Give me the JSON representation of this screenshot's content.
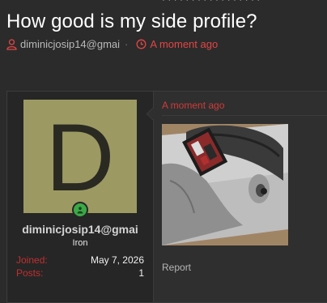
{
  "thread": {
    "title": "How good is my side profile?",
    "author": "diminicjosip14@gmai",
    "date": "A moment ago"
  },
  "post": {
    "avatar_letter": "D",
    "username": "diminicjosip14@gmai",
    "user_title": "Iron",
    "stats": [
      {
        "label": "Joined:",
        "value": "May 7, 2026"
      },
      {
        "label": "Posts:",
        "value": "1"
      }
    ],
    "date": "A moment ago",
    "report_label": "Report"
  },
  "colors": {
    "accent_red": "#d23a3a",
    "online_green": "#3aaa46",
    "avatar_bg": "#9c9a62"
  },
  "icons": {
    "author": "user-icon",
    "date": "clock-icon",
    "online": "online-status-icon"
  }
}
